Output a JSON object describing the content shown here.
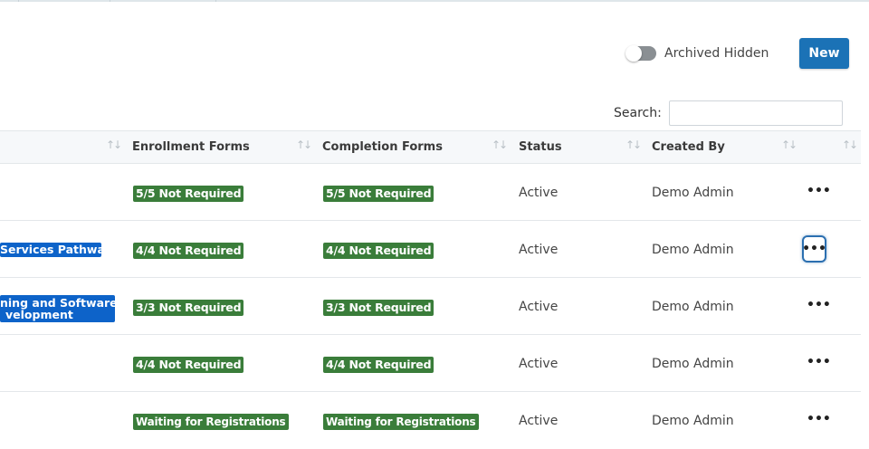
{
  "toolbar": {
    "archived_label": "Archived Hidden",
    "new_label": "New"
  },
  "search": {
    "label": "Search:",
    "value": "",
    "placeholder": ""
  },
  "table": {
    "columns": [
      {
        "label": ""
      },
      {
        "label": "Enrollment Forms"
      },
      {
        "label": "Completion Forms"
      },
      {
        "label": "Status"
      },
      {
        "label": "Created By"
      },
      {
        "label": ""
      }
    ],
    "sort_icon": "↑↓",
    "action_icon": "•••",
    "rows": [
      {
        "pathway": "",
        "enrollment": "5/5 Not Required",
        "completion": "5/5 Not Required",
        "status": "Active",
        "created_by": "Demo Admin"
      },
      {
        "pathway": "Services Pathway",
        "enrollment": "4/4 Not Required",
        "completion": "4/4 Not Required",
        "status": "Active",
        "created_by": "Demo Admin"
      },
      {
        "pathway_line1": "ning and Software",
        "pathway_line2": "velopment",
        "enrollment": "3/3 Not Required",
        "completion": "3/3 Not Required",
        "status": "Active",
        "created_by": "Demo Admin"
      },
      {
        "pathway": "",
        "enrollment": "4/4 Not Required",
        "completion": "4/4 Not Required",
        "status": "Active",
        "created_by": "Demo Admin"
      },
      {
        "pathway": "",
        "enrollment": "Waiting for Registrations",
        "completion": "Waiting for Registrations",
        "status": "Active",
        "created_by": "Demo Admin"
      }
    ]
  },
  "colors": {
    "primary": "#1b72b6",
    "badge_green": "#3a7d3a",
    "pathway_blue": "#0d63c9"
  },
  "icons": {
    "toggle": "toggle-switch",
    "sort": "sort-arrows-icon",
    "actions": "ellipsis-icon"
  }
}
